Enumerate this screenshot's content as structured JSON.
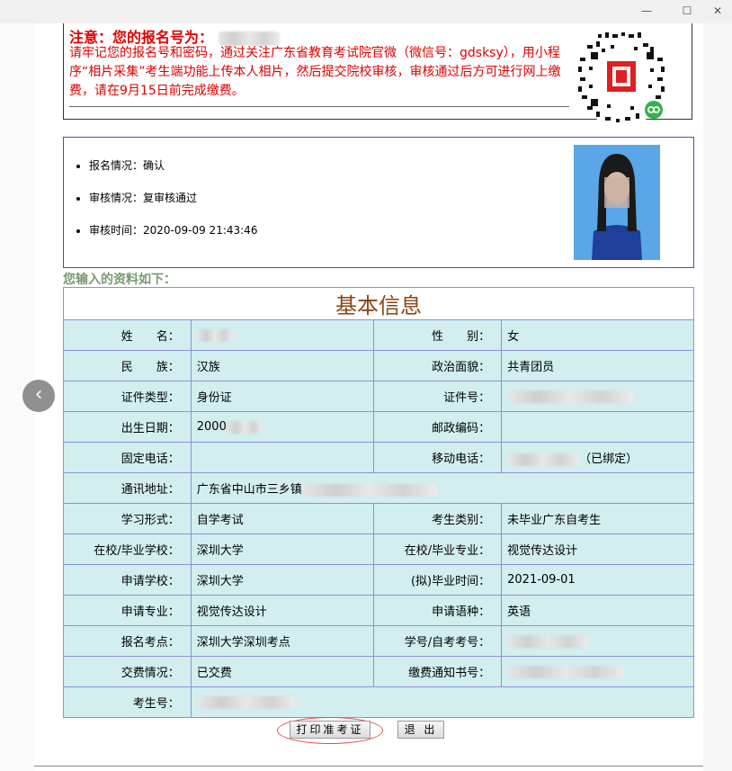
{
  "window": {
    "minimize_glyph": "—",
    "maximize_glyph": "☐",
    "close_glyph": "✕"
  },
  "notice": {
    "title": "注意：您的报名号为：",
    "body": "请牢记您的报名号和密码，通过关注广东省教育考试院官微（微信号：gdsksy），用小程序“相片采集”考生端功能上传本人相片，然后提交院校审核，审核通过后方可进行网上缴费，请在9月15日前完成缴费。"
  },
  "status": {
    "items": [
      "报名情况：确认",
      "审核情况：复审核通过",
      "审核时间：2020-09-09 21:43:46"
    ]
  },
  "intro": "您输入的资料如下：",
  "table": {
    "caption": "基本信息",
    "rows": [
      {
        "l1": "姓　　名：",
        "v1": "",
        "l2": "性　　别：",
        "v2": "女"
      },
      {
        "l1": "民　　族：",
        "v1": "汉族",
        "l2": "政治面貌：",
        "v2": "共青团员"
      },
      {
        "l1": "证件类型：",
        "v1": "身份证",
        "l2": "证件号：",
        "v2": ""
      },
      {
        "l1": "出生日期：",
        "v1": "2000",
        "l2": "邮政编码：",
        "v2": ""
      },
      {
        "l1": "固定电话：",
        "v1": "",
        "l2": "移动电话：",
        "v2": "（已绑定）"
      },
      {
        "l1": "通讯地址：",
        "v1": "广东省中山市三乡镇"
      },
      {
        "l1": "学习形式：",
        "v1": "自学考试",
        "l2": "考生类别：",
        "v2": "未毕业广东自考生"
      },
      {
        "l1": "在校/毕业学校：",
        "v1": "深圳大学",
        "l2": "在校/毕业专业：",
        "v2": "视觉传达设计"
      },
      {
        "l1": "申请学校：",
        "v1": "深圳大学",
        "l2": "(拟)毕业时间：",
        "v2": "2021-09-01"
      },
      {
        "l1": "申请专业：",
        "v1": "视觉传达设计",
        "l2": "申请语种：",
        "v2": "英语"
      },
      {
        "l1": "报名考点：",
        "v1": "深圳大学深圳考点",
        "l2": "学号/自考考号：",
        "v2": ""
      },
      {
        "l1": "交费情况：",
        "v1": "已交费",
        "l2": "缴费通知书号：",
        "v2": ""
      },
      {
        "l1": "考生号：",
        "v1": ""
      }
    ]
  },
  "buttons": {
    "print": "打印准考证",
    "exit": "退 出"
  },
  "nav": {
    "prev_glyph": "‹"
  }
}
